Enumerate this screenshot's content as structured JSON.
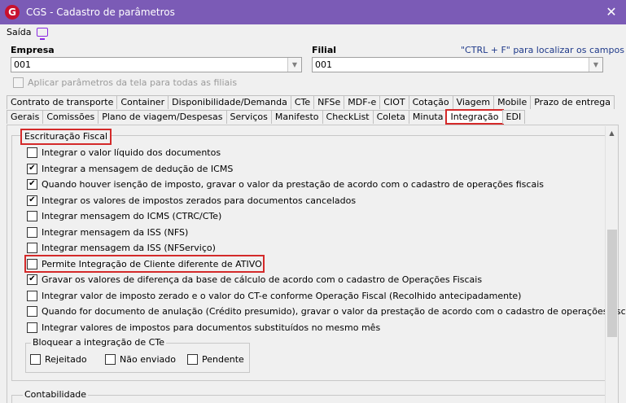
{
  "window": {
    "title": "CGS - Cadastro de parâmetros",
    "close_label": "✕",
    "app_icon_letter": "G"
  },
  "toolbar": {
    "saida_label": "Saída"
  },
  "empresa": {
    "label": "Empresa",
    "value": "001"
  },
  "filial": {
    "label": "Filial",
    "value": "001"
  },
  "hint_text": "\"CTRL + F\" para localizar os campos",
  "apply_all_label": "Aplicar parâmetros da tela para todas as filiais",
  "tabs_row1": [
    "Contrato de transporte",
    "Container",
    "Disponibilidade/Demanda",
    "CTe",
    "NFSe",
    "MDF-e",
    "CIOT",
    "Cotação",
    "Viagem",
    "Mobile",
    "Prazo de entrega"
  ],
  "tabs_row2": [
    "Gerais",
    "Comissões",
    "Plano de viagem/Despesas",
    "Serviços",
    "Manifesto",
    "CheckList",
    "Coleta",
    "Minuta",
    "Integração",
    "EDI"
  ],
  "escrituracao": {
    "title": "Escrituração Fiscal",
    "options": [
      {
        "label": "Integrar o valor líquido dos documentos",
        "checked": false
      },
      {
        "label": "Integrar a mensagem de dedução de ICMS",
        "checked": true
      },
      {
        "label": "Quando houver isenção de imposto, gravar o valor da prestação de acordo com o cadastro de operações fiscais",
        "checked": true
      },
      {
        "label": "Integrar os valores de impostos zerados para documentos cancelados",
        "checked": true
      },
      {
        "label": "Integrar mensagem do ICMS (CTRC/CTe)",
        "checked": false
      },
      {
        "label": "Integrar mensagem da ISS (NFS)",
        "checked": false
      },
      {
        "label": "Integrar mensagem da ISS (NFServiço)",
        "checked": false
      },
      {
        "label": "Permite Integração de Cliente diferente de ATIVO",
        "checked": false
      },
      {
        "label": "Gravar os valores de diferença da base de cálculo de acordo com o cadastro de Operações Fiscais",
        "checked": true
      },
      {
        "label": "Integrar valor de imposto zerado e o valor do CT-e conforme Operação Fiscal (Recolhido antecipadamente)",
        "checked": false
      },
      {
        "label": "Quando for documento de anulação (Crédito presumido), gravar o valor da prestação de acordo com o cadastro de operações fiscais",
        "checked": false
      },
      {
        "label": "Integrar valores de impostos para documentos substituídos no mesmo mês",
        "checked": false
      }
    ]
  },
  "bloquear": {
    "title": "Bloquear a integração de CTe",
    "options": [
      {
        "label": "Rejeitado",
        "checked": false
      },
      {
        "label": "Não enviado",
        "checked": false
      },
      {
        "label": "Pendente",
        "checked": false
      }
    ]
  },
  "contabilidade": {
    "title": "Contabilidade"
  }
}
